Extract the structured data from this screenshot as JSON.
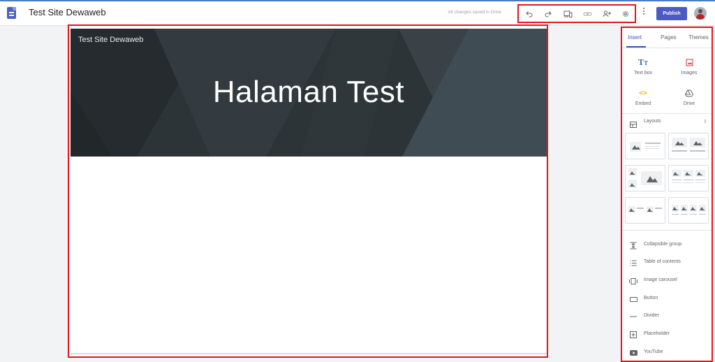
{
  "app": {
    "site_title": "Test Site Dewaweb",
    "save_status": "All changes saved in Drive"
  },
  "toolbar": {
    "icons": [
      "undo-icon",
      "redo-icon",
      "preview-device-icon",
      "link-icon",
      "share-person-add-icon",
      "settings-gear-icon"
    ],
    "more_icon": "more-vert-icon",
    "publish_label": "Publish",
    "accent_color": "#4a5bc4"
  },
  "page": {
    "header_site_name": "Test Site Dewaweb",
    "header_title": "Halaman Test",
    "header_bg_color": "#2d3438"
  },
  "panel": {
    "tabs": [
      {
        "label": "Insert",
        "active": true
      },
      {
        "label": "Pages",
        "active": false
      },
      {
        "label": "Themes",
        "active": false
      }
    ],
    "insert_tiles": [
      {
        "label": "Text box",
        "icon": "text-box-icon"
      },
      {
        "label": "Images",
        "icon": "image-icon"
      },
      {
        "label": "Embed",
        "icon": "embed-code-icon"
      },
      {
        "label": "Drive",
        "icon": "drive-icon"
      }
    ],
    "layouts_label": "Layouts",
    "components": [
      {
        "label": "Collapsible group",
        "icon": "collapsible-group-icon"
      },
      {
        "label": "Table of contents",
        "icon": "table-of-contents-icon"
      },
      {
        "label": "Image carousel",
        "icon": "image-carousel-icon"
      },
      {
        "label": "Button",
        "icon": "button-icon"
      },
      {
        "label": "Divider",
        "icon": "divider-icon"
      },
      {
        "label": "Placeholder",
        "icon": "placeholder-icon"
      },
      {
        "label": "YouTube",
        "icon": "youtube-icon"
      }
    ]
  }
}
